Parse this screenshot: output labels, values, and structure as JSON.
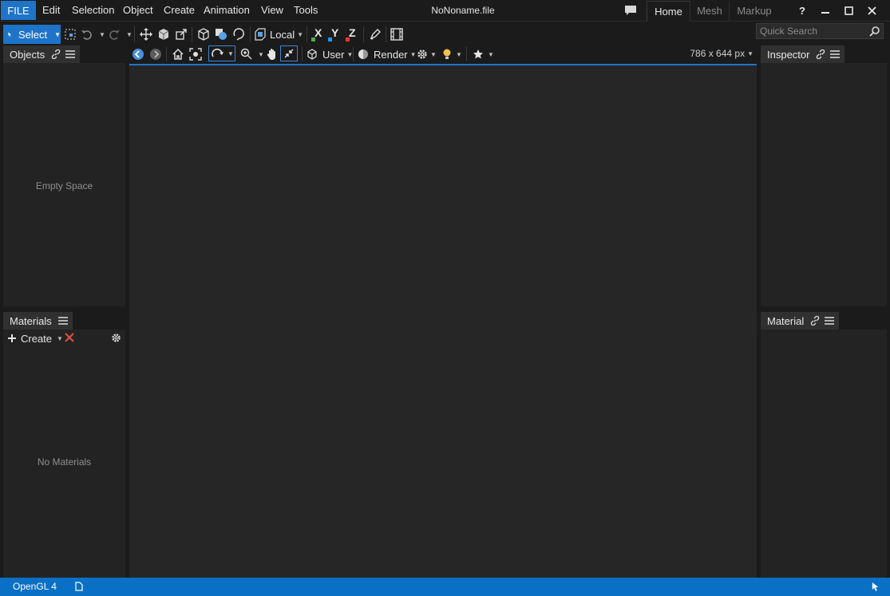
{
  "menubar": {
    "file": "FILE",
    "items": [
      "Edit",
      "Selection",
      "Object",
      "Create",
      "Animation",
      "View",
      "Tools"
    ],
    "document_title": "NoNoname.file",
    "workspace_tabs": [
      "Home",
      "Mesh",
      "Markup"
    ],
    "active_tab": "Home",
    "help": "?"
  },
  "toolbar": {
    "select_label": "Select",
    "coord_label": "Local",
    "axis_x": "X",
    "axis_y": "Y",
    "axis_z": "Z",
    "search_placeholder": "Quick Search"
  },
  "objects_panel": {
    "title": "Objects",
    "empty": "Empty Space"
  },
  "materials_panel": {
    "title": "Materials",
    "create_label": "Create",
    "empty": "No Materials"
  },
  "viewport": {
    "camera_label": "User",
    "render_label": "Render",
    "size_label": "786 x 644 px"
  },
  "inspector_panel": {
    "title": "Inspector"
  },
  "material_panel": {
    "title": "Material"
  },
  "statusbar": {
    "renderer": "OpenGL 4"
  },
  "colors": {
    "accent": "#1e74c8",
    "status_bar": "#0a70c6",
    "axis_x": "#4caf50",
    "axis_y": "#2196f3",
    "axis_z": "#e53935",
    "delete": "#e0533d"
  }
}
